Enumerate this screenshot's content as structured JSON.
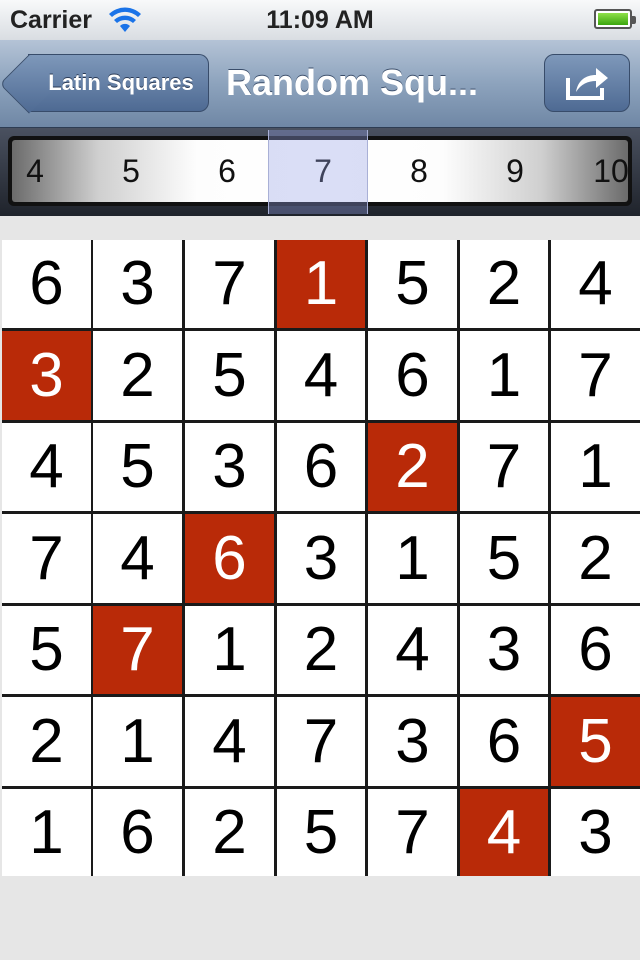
{
  "status_bar": {
    "carrier": "Carrier",
    "time": "11:09 AM"
  },
  "nav": {
    "back_label": "Latin Squares",
    "title": "Random Squ..."
  },
  "picker": {
    "options": [
      "4",
      "5",
      "6",
      "7",
      "8",
      "9",
      "10"
    ],
    "selected": "7"
  },
  "grid": {
    "rows": [
      [
        "6",
        "3",
        "7",
        "1",
        "5",
        "2",
        "4"
      ],
      [
        "3",
        "2",
        "5",
        "4",
        "6",
        "1",
        "7"
      ],
      [
        "4",
        "5",
        "3",
        "6",
        "2",
        "7",
        "1"
      ],
      [
        "7",
        "4",
        "6",
        "3",
        "1",
        "5",
        "2"
      ],
      [
        "5",
        "7",
        "1",
        "2",
        "4",
        "3",
        "6"
      ],
      [
        "2",
        "1",
        "4",
        "7",
        "3",
        "6",
        "5"
      ],
      [
        "1",
        "6",
        "2",
        "5",
        "7",
        "4",
        "3"
      ]
    ],
    "highlighted_columns_by_row": [
      3,
      0,
      4,
      2,
      1,
      6,
      5
    ],
    "highlight_color": "#b92a08"
  },
  "icons": {
    "share": "share-icon",
    "wifi": "wifi-icon",
    "battery": "battery-icon"
  }
}
